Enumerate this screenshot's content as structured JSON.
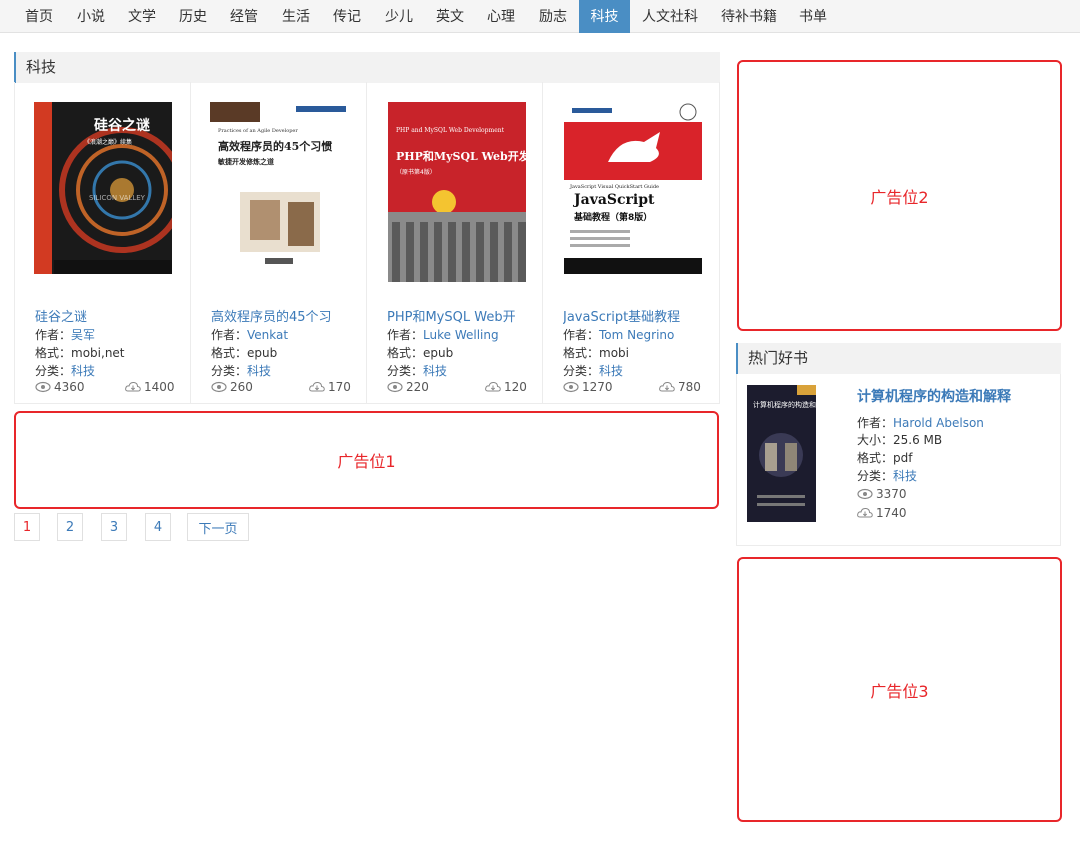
{
  "nav": {
    "items": [
      "首页",
      "小说",
      "文学",
      "历史",
      "经管",
      "生活",
      "传记",
      "少儿",
      "英文",
      "心理",
      "励志",
      "科技",
      "人文社科",
      "待补书籍",
      "书单"
    ],
    "active": "科技"
  },
  "section": {
    "title": "科技"
  },
  "books": [
    {
      "title": "硅谷之谜",
      "author_label": "作者：",
      "author": "吴军",
      "format_label": "格式：",
      "format": "mobi,net",
      "category_label": "分类：",
      "category": "科技",
      "views": "4360",
      "downloads": "1400"
    },
    {
      "title": "高效程序员的45个习",
      "author_label": "作者：",
      "author": "Venkat",
      "format_label": "格式：",
      "format": "epub",
      "category_label": "分类：",
      "category": "科技",
      "views": "260",
      "downloads": "170"
    },
    {
      "title": "PHP和MySQL Web开",
      "author_label": "作者：",
      "author": "Luke Welling",
      "format_label": "格式：",
      "format": "epub",
      "category_label": "分类：",
      "category": "科技",
      "views": "220",
      "downloads": "120"
    },
    {
      "title": "JavaScript基础教程",
      "author_label": "作者：",
      "author": "Tom Negrino",
      "format_label": "格式：",
      "format": "mobi",
      "category_label": "分类：",
      "category": "科技",
      "views": "1270",
      "downloads": "780"
    }
  ],
  "covers": [
    {
      "title": "硅谷之谜",
      "subtitle": "《浪潮之巅》续集",
      "extra": "SILICON VALLEY",
      "accent": "#d23a22"
    },
    {
      "title": "高效程序员的45个习惯",
      "subtitle": "敏捷开发修炼之道",
      "extra": "Practices of an Agile Developer",
      "accent": "#5a3a26"
    },
    {
      "title": "PHP和MySQL Web开发",
      "subtitle": "（原书第4版）",
      "extra": "PHP and MySQL Web Development",
      "accent": "#c8232a"
    },
    {
      "title": "JavaScript",
      "subtitle": "基础教程（第8版）",
      "extra": "JavaScript Visual QuickStart Guide",
      "accent": "#d9232a"
    }
  ],
  "ads": {
    "ad1": "广告位1",
    "ad2": "广告位2",
    "ad3": "广告位3"
  },
  "pagination": {
    "pages": [
      "1",
      "2",
      "3",
      "4"
    ],
    "next": "下一页",
    "current": "1"
  },
  "hot": {
    "title": "热门好书",
    "book": {
      "title": "计算机程序的构造和解释",
      "author_label": "作者：",
      "author": "Harold Abelson",
      "size_label": "大小：",
      "size": "25.6 MB",
      "format_label": "格式：",
      "format": "pdf",
      "category_label": "分类：",
      "category": "科技",
      "views": "3370",
      "downloads": "1740",
      "cover_title": "计算机程序的构造和解释"
    }
  },
  "colors": {
    "link": "#3c7ab8",
    "active_nav": "#4a8ec4",
    "ad_border": "#e8262a"
  },
  "icons": {
    "views": "eye-icon",
    "downloads": "cloud-download-icon"
  }
}
